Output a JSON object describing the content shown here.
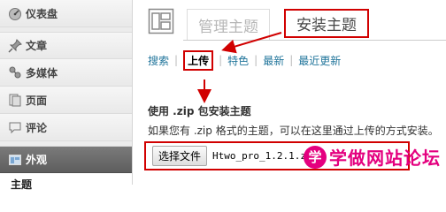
{
  "sidebar": {
    "items": [
      {
        "label": "仪表盘",
        "icon": "dashboard-icon"
      },
      {
        "label": "文章",
        "icon": "pushpin-icon"
      },
      {
        "label": "多媒体",
        "icon": "media-icon"
      },
      {
        "label": "页面",
        "icon": "page-icon"
      },
      {
        "label": "评论",
        "icon": "comment-bubble-icon"
      },
      {
        "label": "外观",
        "icon": "appearance-icon"
      }
    ],
    "submenu": {
      "label": "主题"
    }
  },
  "tabs": {
    "manage": "管理主题",
    "install": "安装主题"
  },
  "subsub": {
    "search": "搜索",
    "upload": "上传",
    "featured": "特色",
    "newest": "最新",
    "recent": "最近更新",
    "sep": "|"
  },
  "section": {
    "title": "使用 .zip 包安装主题",
    "description": "如果您有 .zip 格式的主题，可以在这里通过上传的方式安装。"
  },
  "upload": {
    "button_label": "选择文件",
    "file_name": "Htwo_pro_1.2.1.zi"
  },
  "watermark": {
    "logo_char": "学",
    "text": "学做网站论坛"
  },
  "colors": {
    "highlight": "#d10000",
    "link": "#21759b",
    "active_menu": "#6d6d6d",
    "watermark": "#e4007f"
  }
}
